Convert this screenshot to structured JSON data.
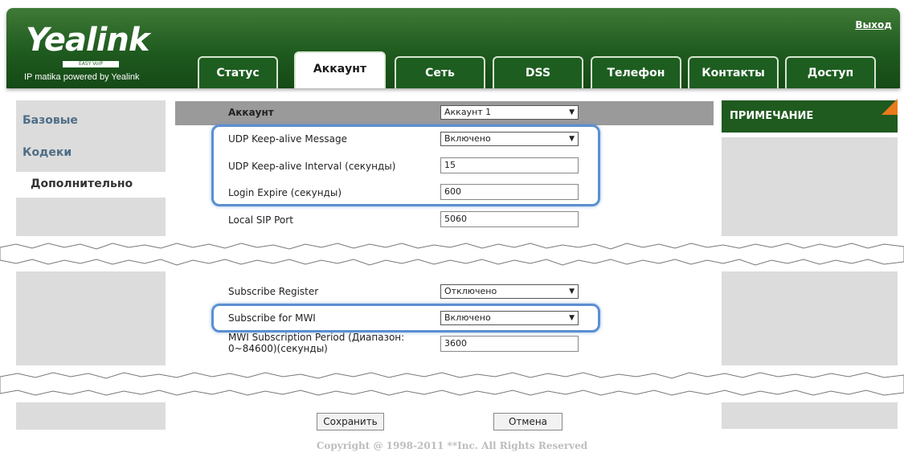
{
  "header": {
    "logo": "Yealink",
    "logo_sub": "EASY VoIP",
    "tagline": "IP matika powered by Yealink",
    "logout": "Выход"
  },
  "tabs": [
    {
      "label": "Статус"
    },
    {
      "label": "Аккаунт",
      "active": true
    },
    {
      "label": "Сеть"
    },
    {
      "label": "DSS"
    },
    {
      "label": "Телефон"
    },
    {
      "label": "Контакты"
    },
    {
      "label": "Доступ"
    }
  ],
  "sidebar": {
    "items": [
      {
        "label": "Базовые"
      },
      {
        "label": "Кодеки"
      },
      {
        "label": "Дополнительно",
        "active": true
      }
    ]
  },
  "note": {
    "title": "ПРИМЕЧАНИЕ"
  },
  "form": {
    "account_label": "Аккаунт",
    "account_value": "Аккаунт 1",
    "udp_keepalive_msg_label": "UDP Keep-alive Message",
    "udp_keepalive_msg_value": "Включено",
    "udp_keepalive_interval_label": "UDP Keep-alive Interval (секунды)",
    "udp_keepalive_interval_value": "15",
    "login_expire_label": "Login Expire (секунды)",
    "login_expire_value": "600",
    "local_sip_port_label": "Local SIP Port",
    "local_sip_port_value": "5060",
    "subscribe_register_label": "Subscribe Register",
    "subscribe_register_value": "Отключено",
    "subscribe_mwi_label": "Subscribe for MWI",
    "subscribe_mwi_value": "Включено",
    "mwi_period_label_line1": "MWI Subscription Period (Диапазон:",
    "mwi_period_label_line2": "0~84600)(секунды)",
    "mwi_period_value": "3600"
  },
  "buttons": {
    "save": "Сохранить",
    "cancel": "Отмена"
  },
  "footer": "Copyright @ 1998-2011 **Inc. All Rights Reserved",
  "colors": {
    "brand_green": "#1f5a1f",
    "highlight": "#5b8fd0",
    "note_corner": "#e87a1c"
  }
}
